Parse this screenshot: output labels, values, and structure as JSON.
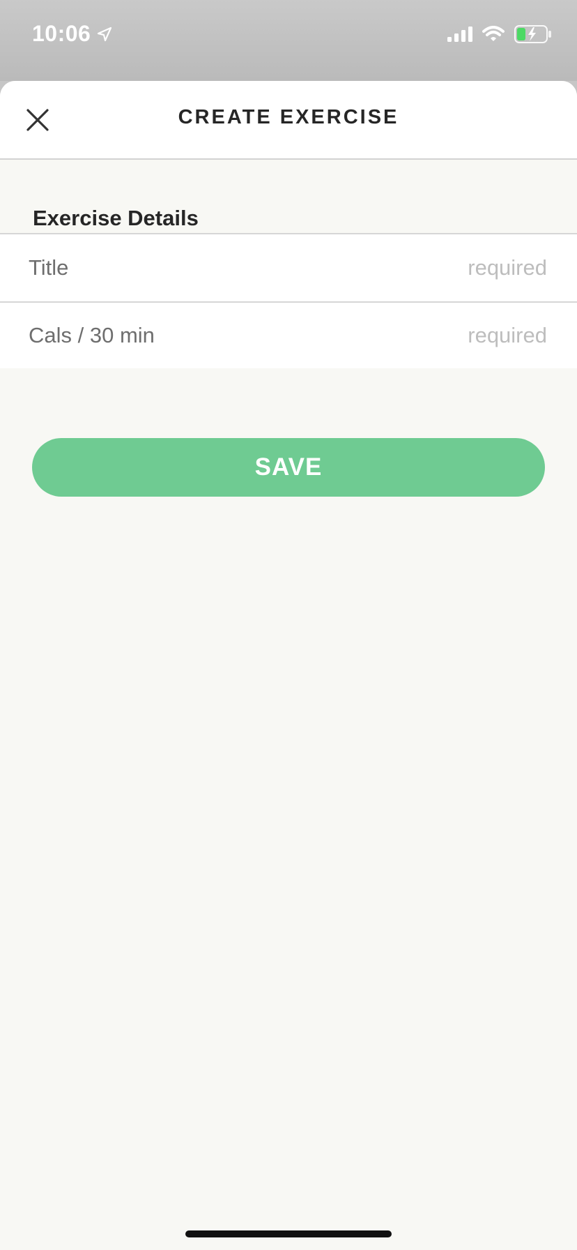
{
  "status_bar": {
    "time": "10:06",
    "icons": [
      "location-arrow-icon",
      "signal-icon",
      "wifi-icon",
      "battery-charging-icon"
    ]
  },
  "header": {
    "title": "CREATE EXERCISE",
    "close_icon": "close-icon"
  },
  "section": {
    "heading": "Exercise Details"
  },
  "fields": [
    {
      "label": "Title",
      "placeholder": "required",
      "value": ""
    },
    {
      "label": "Cals / 30 min",
      "placeholder": "required",
      "value": ""
    }
  ],
  "save_button": {
    "label": "SAVE"
  },
  "colors": {
    "accent": "#6fcb92",
    "background": "#f8f8f4",
    "battery_fill": "#4cd964"
  }
}
